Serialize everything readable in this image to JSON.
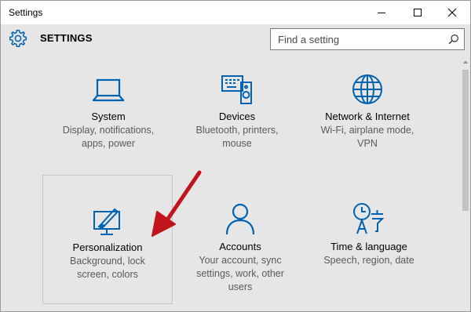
{
  "window": {
    "title": "Settings",
    "controls": [
      "minimize",
      "maximize",
      "close"
    ]
  },
  "header": {
    "icon": "gear-icon",
    "title": "SETTINGS",
    "search_placeholder": "Find a setting",
    "search_value": ""
  },
  "tiles": [
    {
      "title": "System",
      "desc_line1": "Display, notifications,",
      "desc_line2": "apps, power",
      "desc_line3": "",
      "icon": "laptop-icon"
    },
    {
      "title": "Devices",
      "desc_line1": "Bluetooth, printers,",
      "desc_line2": "mouse",
      "desc_line3": "",
      "icon": "devices-icon"
    },
    {
      "title": "Network & Internet",
      "desc_line1": "Wi-Fi, airplane mode,",
      "desc_line2": "VPN",
      "desc_line3": "",
      "icon": "globe-icon"
    },
    {
      "title": "Personalization",
      "desc_line1": "Background, lock",
      "desc_line2": "screen, colors",
      "desc_line3": "",
      "icon": "personalization-icon"
    },
    {
      "title": "Accounts",
      "desc_line1": "Your account, sync",
      "desc_line2": "settings, work, other",
      "desc_line3": "users",
      "icon": "person-icon"
    },
    {
      "title": "Time & language",
      "desc_line1": "Speech, region, date",
      "desc_line2": "",
      "desc_line3": "",
      "icon": "time-language-icon"
    }
  ],
  "colors": {
    "accent": "#0063b1",
    "annotation_arrow": "#c0151b",
    "background": "#e6e6e6"
  }
}
